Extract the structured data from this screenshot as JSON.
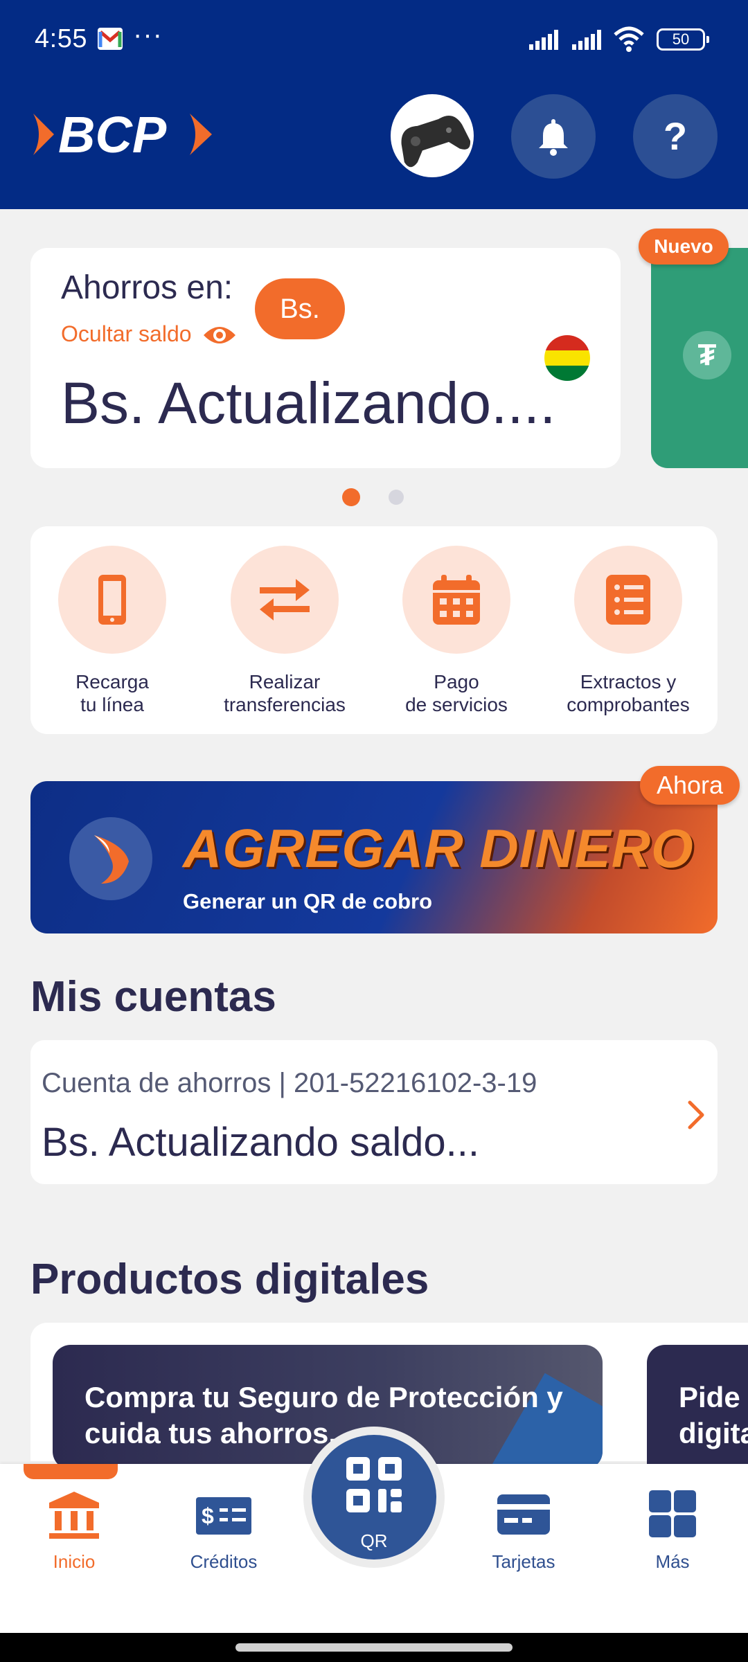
{
  "status_bar": {
    "time": "4:55",
    "dots": "···",
    "battery": "50"
  },
  "header": {
    "logo_text": "BCP",
    "help_label": "?"
  },
  "balance_card": {
    "label": "Ahorros en:",
    "currency": "Bs.",
    "hide_label": "Ocultar saldo",
    "value": "Bs. Actualizando...."
  },
  "next_card": {
    "badge": "Nuevo"
  },
  "carousel": {
    "pages": 2,
    "active": 1
  },
  "quick_actions": [
    {
      "label": "Recarga\ntu línea",
      "icon": "phone-icon"
    },
    {
      "label": "Realizar\ntransferencias",
      "icon": "transfer-icon"
    },
    {
      "label": "Pago\nde servicios",
      "icon": "calendar-icon"
    },
    {
      "label": "Extractos y\ncomprobantes",
      "icon": "list-icon"
    }
  ],
  "banner": {
    "title": "AGREGAR DINERO",
    "subtitle": "Generar un QR de cobro",
    "badge": "Ahora"
  },
  "accounts": {
    "title": "Mis cuentas",
    "items": [
      {
        "name": "Cuenta de ahorros | 201-52216102-3-19",
        "balance": "Bs. Actualizando saldo..."
      }
    ]
  },
  "products": {
    "title": "Productos digitales",
    "cards": [
      {
        "text": "Compra tu Seguro de Protección y\ncuida tus ahorros."
      },
      {
        "text": "Pide t\ndigita"
      }
    ]
  },
  "bottom_nav": {
    "items": [
      {
        "label": "Inicio",
        "icon": "bank-icon",
        "active": true
      },
      {
        "label": "Créditos",
        "icon": "credit-icon",
        "active": false
      },
      {
        "label": "QR",
        "icon": "qr-icon",
        "active": false
      },
      {
        "label": "Tarjetas",
        "icon": "card-icon",
        "active": false
      },
      {
        "label": "Más",
        "icon": "grid-icon",
        "active": false
      }
    ]
  },
  "colors": {
    "brand_blue": "#032b85",
    "accent_orange": "#f26c2b",
    "nav_blue": "#2f5597",
    "text_dark": "#2c2a50"
  }
}
